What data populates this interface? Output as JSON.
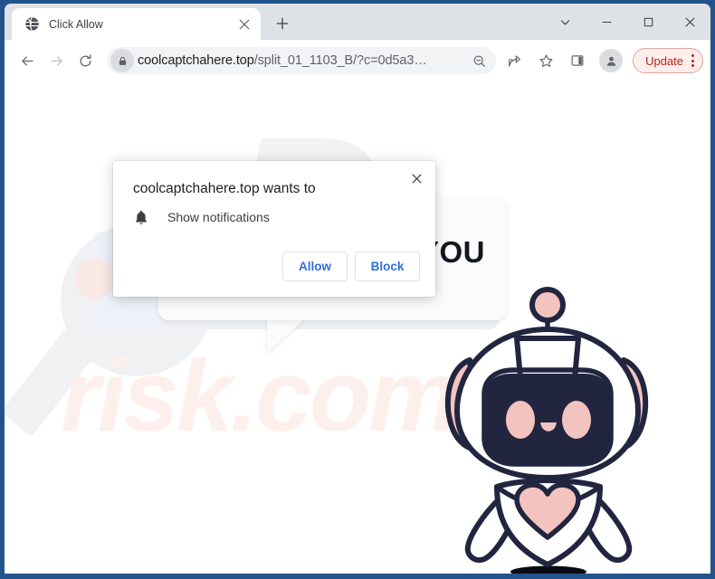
{
  "browser": {
    "tab": {
      "title": "Click Allow",
      "favicon": "globe-icon",
      "close_label": "×"
    },
    "new_tab_label": "+",
    "window_controls": {
      "tab_search": "tab-search-chevron-icon",
      "minimize": "—",
      "maximize": "□",
      "close": "×"
    },
    "toolbar": {
      "back": "back-arrow-icon",
      "forward": "forward-arrow-icon",
      "reload": "reload-icon",
      "url_domain": "coolcaptchahere.top",
      "url_path": "/split_01_1103_B/?c=0d5a3…",
      "url_full": "coolcaptchahere.top/split_01_1103_B/?c=0d5a3…",
      "lock_icon": "lock-icon",
      "zoom_icon": "zoom-out-icon",
      "share_icon": "share-icon",
      "bookmark_icon": "star-icon",
      "sidepanel_icon": "side-panel-icon",
      "profile_icon": "profile-avatar-icon",
      "update_label": "Update",
      "menu_icon": "kebab-menu-icon"
    }
  },
  "dialog": {
    "title": "coolcaptchahere.top wants to",
    "permission_label": "Show notifications",
    "permission_icon": "bell-icon",
    "allow_label": "Allow",
    "block_label": "Block",
    "close_label": "×"
  },
  "page": {
    "bubble_text": "YOU",
    "watermark_p": "P",
    "watermark_risk": "risk.com",
    "robot_alt": "robot-mascot"
  },
  "colors": {
    "window_frame": "#23538c",
    "tabstrip": "#dee1e6",
    "omnibox": "#f1f3f4",
    "link_blue": "#2f6fe0",
    "update_red": "#b3261e",
    "robot_outline": "#22253f",
    "robot_pink": "#f3c3bf",
    "watermark_gray": "#f0f1f3",
    "watermark_peach": "#fdf0ec",
    "card_blue": "#eef1f8"
  }
}
